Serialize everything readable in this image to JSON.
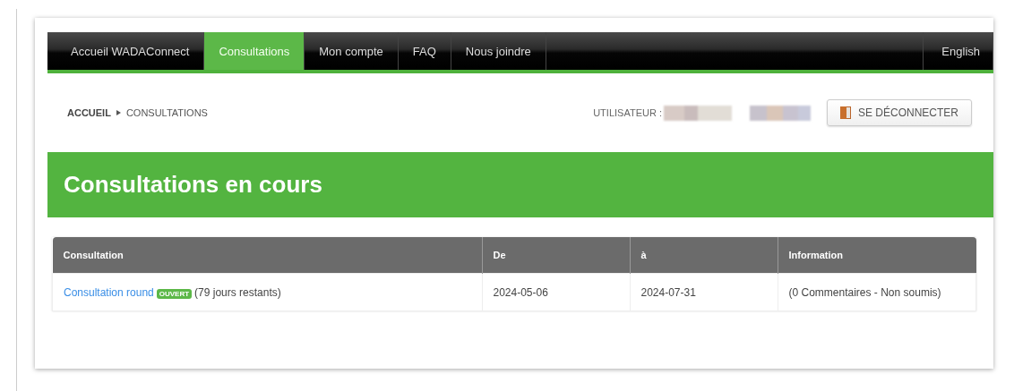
{
  "nav": {
    "items": [
      {
        "label": "Accueil WADAConnect",
        "selected": false
      },
      {
        "label": "Consultations",
        "selected": true
      },
      {
        "label": "Mon compte",
        "selected": false
      },
      {
        "label": "FAQ",
        "selected": false
      },
      {
        "label": "Nous joindre",
        "selected": false
      }
    ],
    "language": "English"
  },
  "breadcrumb": [
    {
      "label": "ACCUEIL"
    },
    {
      "label": "CONSULTATIONS"
    }
  ],
  "user": {
    "label": "UTILISATEUR :"
  },
  "logout_button": "SE DÉCONNECTER",
  "banner": {
    "title": "Consultations en cours"
  },
  "table": {
    "columns": [
      "Consultation",
      "De",
      "à",
      "Information"
    ],
    "rows": [
      {
        "link": "Consultation round",
        "badge": "OUVERT",
        "remaining": "(79 jours restants)",
        "from": "2024-05-06",
        "to": "2024-07-31",
        "info": "(0 Commentaires - Non soumis)"
      }
    ]
  }
}
